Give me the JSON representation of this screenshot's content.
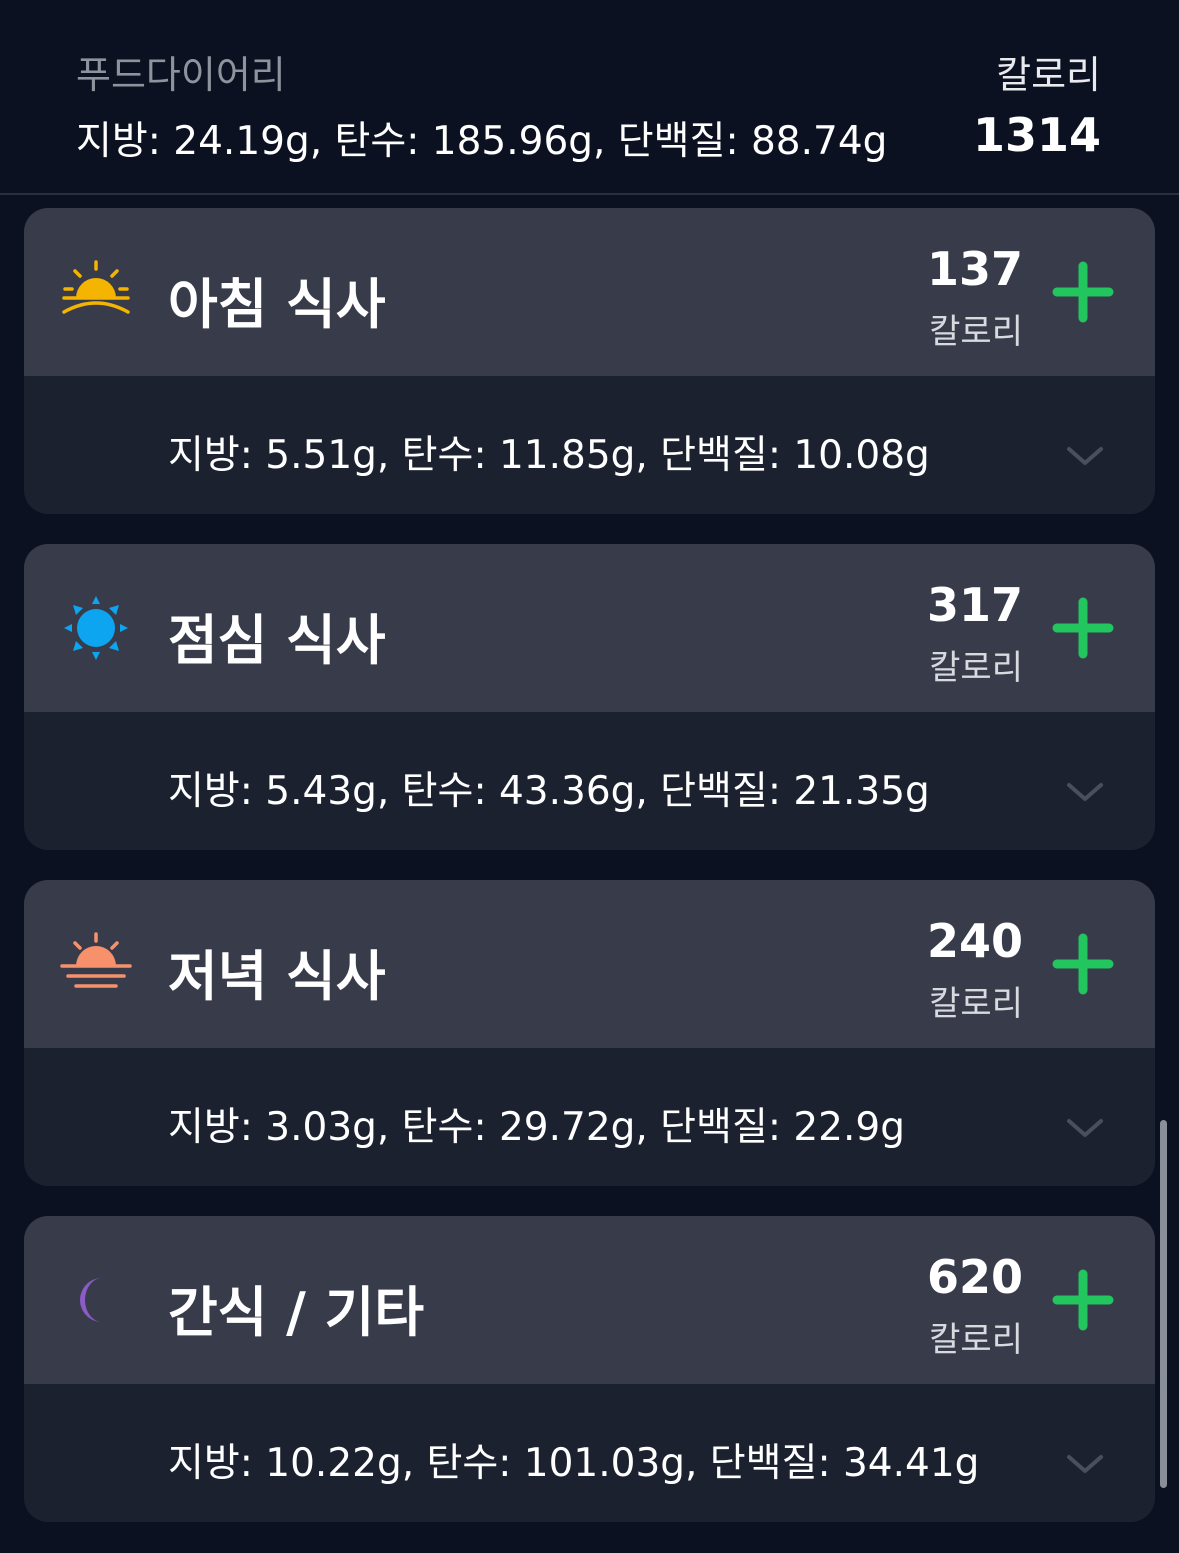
{
  "header": {
    "title": "푸드다이어리",
    "macros": "지방: 24.19g, 탄수: 185.96g, 단백질: 88.74g",
    "calories_label": "칼로리",
    "calories_value": "1314"
  },
  "meals": [
    {
      "title": "아침 식사",
      "icon": "sunrise-icon",
      "calories": "137",
      "calories_label": "칼로리",
      "macros": "지방: 5.51g, 탄수: 11.85g, 단백질: 10.08g"
    },
    {
      "title": "점심 식사",
      "icon": "sun-icon",
      "calories": "317",
      "calories_label": "칼로리",
      "macros": "지방: 5.43g, 탄수: 43.36g, 단백질: 21.35g"
    },
    {
      "title": "저녁 식사",
      "icon": "sunset-icon",
      "calories": "240",
      "calories_label": "칼로리",
      "macros": "지방: 3.03g, 탄수: 29.72g, 단백질: 22.9g"
    },
    {
      "title": "간식 / 기타",
      "icon": "moon-icon",
      "calories": "620",
      "calories_label": "칼로리",
      "macros": "지방: 10.22g, 탄수: 101.03g, 단백질: 34.41g"
    }
  ],
  "colors": {
    "background": "#0b1120",
    "card_top": "#383c4a",
    "card_bottom": "#1c2130",
    "add_green": "#22c55e",
    "sunrise": "#f5b400",
    "sun": "#0ea5f0",
    "sunset": "#f7916c",
    "moon": "#8b5cc8"
  }
}
